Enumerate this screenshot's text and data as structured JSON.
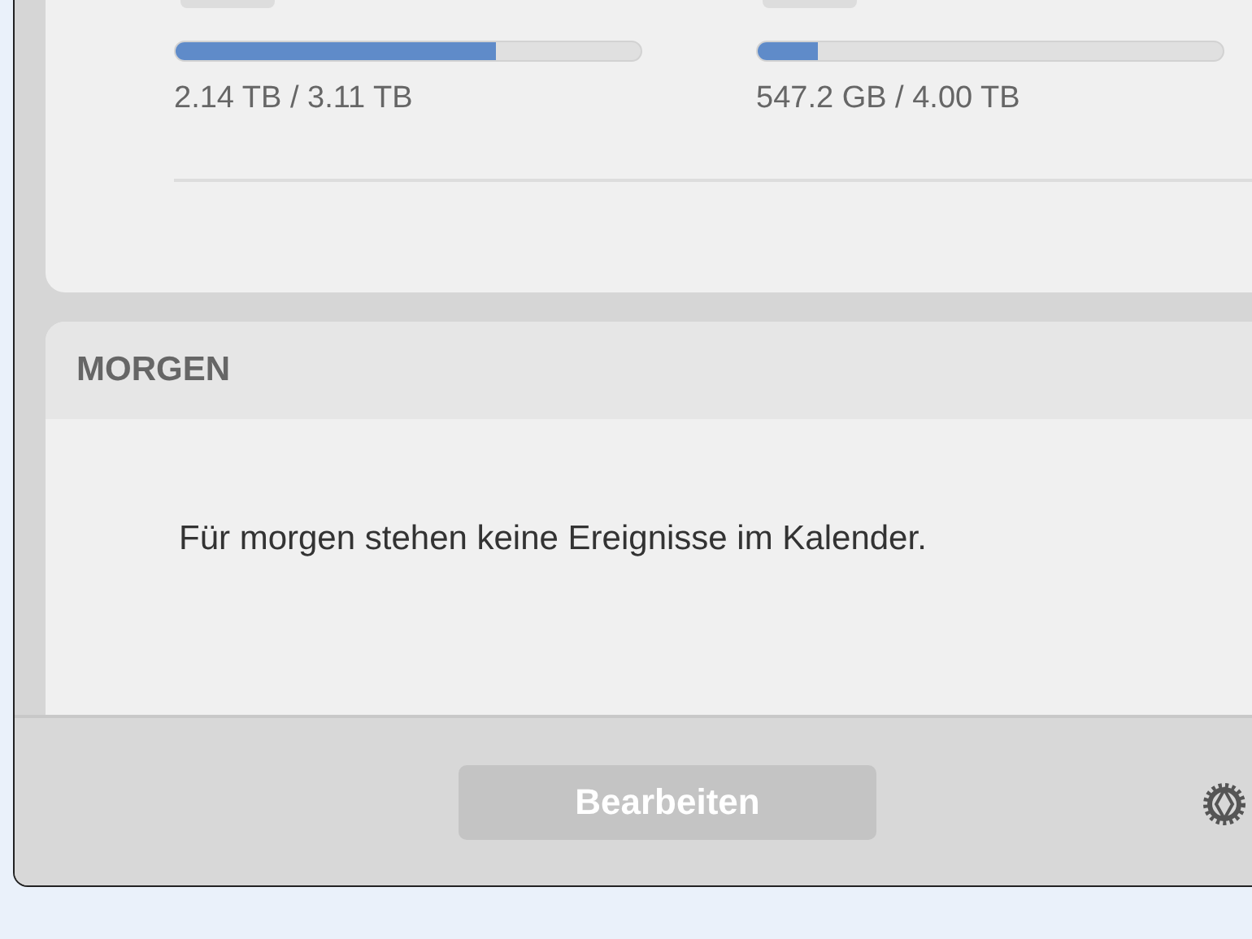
{
  "storage": {
    "drives": [
      {
        "level": 0.69,
        "usage": "2.14 TB / 3.11 TB"
      },
      {
        "level": 0.13,
        "usage": "547.2 GB / 4.00 TB"
      }
    ]
  },
  "tomorrow": {
    "title": "MORGEN",
    "message": "Für morgen stehen keine Ereignisse im Kalender."
  },
  "footer": {
    "edit_button": "Bearbeiten"
  }
}
